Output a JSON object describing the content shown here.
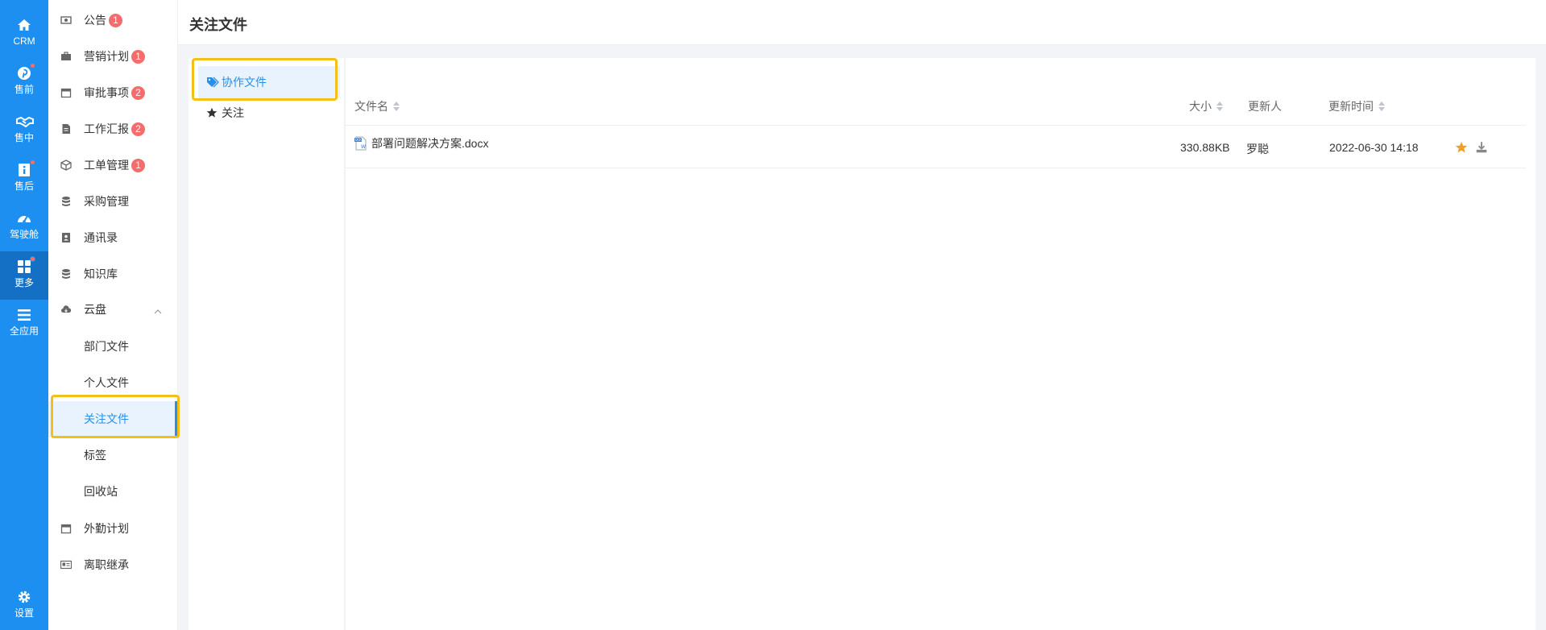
{
  "rail": {
    "items": [
      {
        "label": "CRM",
        "icon": "home-icon"
      },
      {
        "label": "售前",
        "icon": "pinterest-icon"
      },
      {
        "label": "售中",
        "icon": "handshake-icon"
      },
      {
        "label": "售后",
        "icon": "info-icon"
      },
      {
        "label": "驾驶舱",
        "icon": "dashboard-icon"
      },
      {
        "label": "更多",
        "icon": "grid-icon"
      },
      {
        "label": "全应用",
        "icon": "menu-icon"
      },
      {
        "label": "设置",
        "icon": "gear-icon"
      }
    ]
  },
  "sidebar": {
    "items": [
      {
        "label": "公告",
        "badge": "1"
      },
      {
        "label": "营销计划",
        "badge": "1"
      },
      {
        "label": "审批事项",
        "badge": "2"
      },
      {
        "label": "工作汇报",
        "badge": "2"
      },
      {
        "label": "工单管理",
        "badge": "1"
      },
      {
        "label": "采购管理"
      },
      {
        "label": "通讯录"
      },
      {
        "label": "知识库"
      },
      {
        "label": "云盘"
      },
      {
        "label": "外勤计划"
      },
      {
        "label": "离职继承"
      }
    ],
    "cloud_sub": [
      "部门文件",
      "个人文件",
      "关注文件",
      "标签",
      "回收站"
    ]
  },
  "header": {
    "title": "关注文件"
  },
  "left_panel": {
    "items": [
      "协作文件",
      "关注"
    ]
  },
  "table": {
    "columns": {
      "name": "文件名",
      "size": "大小",
      "updater": "更新人",
      "updated_at": "更新时间"
    },
    "rows": [
      {
        "name": "部署问题解决方案.docx",
        "size": "330.88KB",
        "updater": "罗聪",
        "updated_at": "2022-06-30 14:18"
      }
    ]
  },
  "colors": {
    "accent": "#1c8ff0",
    "highlight": "#f5bf1a",
    "badge": "#f56c6c",
    "star": "#f0a020"
  }
}
